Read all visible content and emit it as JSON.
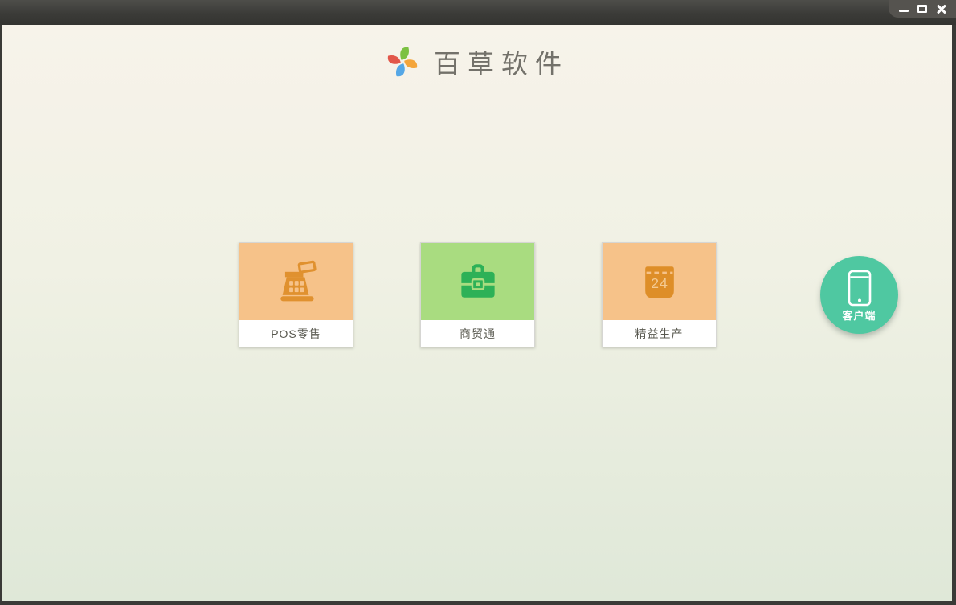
{
  "window": {
    "controls": [
      {
        "name": "minimize"
      },
      {
        "name": "maximize"
      },
      {
        "name": "close"
      }
    ]
  },
  "header": {
    "title": "百草软件",
    "logo_icon": "pinwheel-logo"
  },
  "cards": [
    {
      "label": "POS零售",
      "icon": "cash-register-icon"
    },
    {
      "label": "商贸通",
      "icon": "briefcase-icon"
    },
    {
      "label": "精益生产",
      "icon": "calendar-icon",
      "calendar_day": "24"
    }
  ],
  "client_button": {
    "label": "客户端",
    "icon": "smartphone-icon"
  },
  "colors": {
    "logo-green": "#7cc142",
    "logo-orange": "#f4a53b",
    "logo-blue": "#55a7e6",
    "logo-red": "#e2574a",
    "title-color": "#73716a",
    "label-color": "#58584f",
    "card1-bg": "#f6c289",
    "card1-icon": "#e0912f",
    "card2-bg": "#a9dc80",
    "card2-icon": "#2db157",
    "card3-bg": "#f6c289",
    "card3-icon": "#de8e28",
    "card3-num": "#f4ca92",
    "client-circle": "#4fc8a1"
  }
}
